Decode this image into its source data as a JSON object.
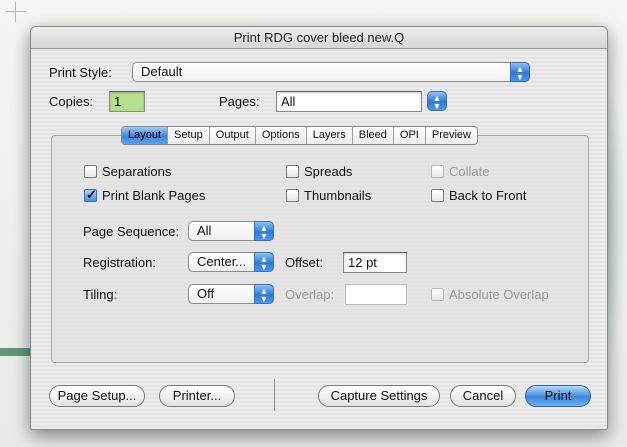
{
  "window": {
    "title": "Print RDG cover bleed new.Q"
  },
  "print_style": {
    "label": "Print Style:",
    "value": "Default"
  },
  "copies": {
    "label": "Copies:",
    "value": "1"
  },
  "pages": {
    "label": "Pages:",
    "value": "All"
  },
  "tabs": [
    {
      "label": "Layout",
      "active": true
    },
    {
      "label": "Setup"
    },
    {
      "label": "Output"
    },
    {
      "label": "Options"
    },
    {
      "label": "Layers"
    },
    {
      "label": "Bleed"
    },
    {
      "label": "OPI"
    },
    {
      "label": "Preview"
    }
  ],
  "checkboxes": {
    "separations": {
      "label": "Separations",
      "checked": false
    },
    "spreads": {
      "label": "Spreads",
      "checked": false
    },
    "collate": {
      "label": "Collate",
      "checked": false,
      "disabled": true
    },
    "print_blank_pages": {
      "label": "Print Blank Pages",
      "checked": true
    },
    "thumbnails": {
      "label": "Thumbnails",
      "checked": false
    },
    "back_to_front": {
      "label": "Back to Front",
      "checked": false
    },
    "absolute_overlap": {
      "label": "Absolute Overlap",
      "checked": false,
      "disabled": true
    }
  },
  "page_sequence": {
    "label": "Page Sequence:",
    "value": "All"
  },
  "registration": {
    "label": "Registration:",
    "value": "Center..."
  },
  "offset": {
    "label": "Offset:",
    "value": "12 pt"
  },
  "tiling": {
    "label": "Tiling:",
    "value": "Off"
  },
  "overlap": {
    "label": "Overlap:",
    "value": ""
  },
  "buttons": {
    "page_setup": "Page Setup...",
    "printer": "Printer...",
    "capture_settings": "Capture Settings",
    "cancel": "Cancel",
    "print": "Print"
  },
  "colors": {
    "accent": "#3f86dc",
    "copies_field": "#b7e08c"
  }
}
